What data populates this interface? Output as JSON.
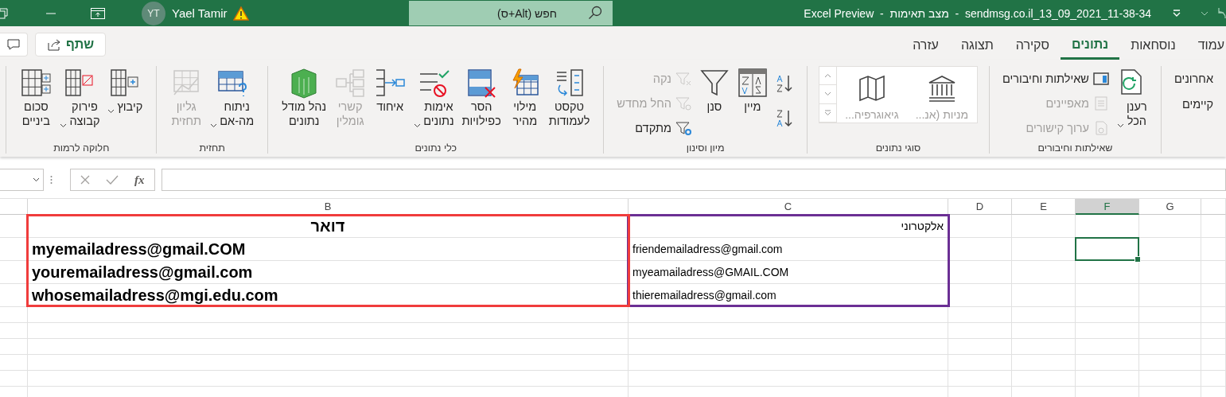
{
  "title_bar": {
    "user": {
      "initials": "YT",
      "name": "Yael Tamir"
    },
    "search": {
      "placeholder": "חפש (Alt+ס)"
    },
    "title": "Excel Preview  -  מצב תאימות  -  sendmsg.co.il_13_09_2021_11-38-34"
  },
  "share_button": {
    "label": "שתף"
  },
  "tabs": [
    {
      "label": "עמוד",
      "selected": false
    },
    {
      "label": "נוסחאות",
      "selected": false
    },
    {
      "label": "נתונים",
      "selected": true
    },
    {
      "label": "סקירה",
      "selected": false
    },
    {
      "label": "תצוגה",
      "selected": false
    },
    {
      "label": "עזרה",
      "selected": false
    }
  ],
  "ribbon": {
    "groups": [
      {
        "items": [
          {
            "kind": "text",
            "label": "אחרונים",
            "disabled": false
          },
          {
            "kind": "text",
            "label": "קיימים",
            "disabled": false
          }
        ]
      },
      {
        "label": "שאילתות וחיבורים",
        "items": [
          {
            "kind": "large",
            "lines": [
              "רענן",
              "הכל"
            ],
            "dropdown": true,
            "disabled": false
          },
          {
            "kind": "small",
            "label": "שאילתות וחיבורים",
            "disabled": false
          },
          {
            "kind": "small",
            "label": "מאפיינים",
            "disabled": true
          },
          {
            "kind": "small",
            "label": "ערוך קישורים",
            "disabled": true
          }
        ]
      },
      {
        "label": "סוגי נתונים",
        "items": [
          {
            "kind": "gallery",
            "label": "מניות (אנ...",
            "disabled": true
          },
          {
            "kind": "gallery",
            "label": "גיאוגרפיה...",
            "disabled": true
          }
        ]
      },
      {
        "label": "מיון וסינון",
        "items": [
          {
            "kind": "icon",
            "disabled": false
          },
          {
            "kind": "icon",
            "disabled": false
          },
          {
            "kind": "large",
            "lines": [
              "מיין"
            ],
            "dropdown": false,
            "disabled": false
          },
          {
            "kind": "large",
            "lines": [
              "סנן"
            ],
            "dropdown": false,
            "disabled": false
          },
          {
            "kind": "small",
            "label": "נקה",
            "disabled": true
          },
          {
            "kind": "small",
            "label": "החל מחדש",
            "disabled": true
          },
          {
            "kind": "small",
            "label": "מתקדם",
            "disabled": false
          }
        ]
      },
      {
        "label": "כלי נתונים",
        "items": [
          {
            "kind": "large",
            "lines": [
              "טקסט",
              "לעמודות"
            ],
            "dropdown": false,
            "disabled": false
          },
          {
            "kind": "large",
            "lines": [
              "מילוי",
              "מהיר"
            ],
            "dropdown": false,
            "disabled": false
          },
          {
            "kind": "large",
            "lines": [
              "הסר",
              "כפילויות"
            ],
            "dropdown": false,
            "disabled": false
          },
          {
            "kind": "large",
            "lines": [
              "אימות",
              "נתונים"
            ],
            "dropdown": true,
            "disabled": false
          },
          {
            "kind": "large",
            "lines": [
              "איחוד"
            ],
            "dropdown": false,
            "disabled": false
          },
          {
            "kind": "large",
            "lines": [
              "קשרי",
              "גומלין"
            ],
            "dropdown": false,
            "disabled": true
          },
          {
            "kind": "large",
            "lines": [
              "נהל מודל",
              "נתונים"
            ],
            "dropdown": false,
            "disabled": false
          }
        ]
      },
      {
        "label": "תחזית",
        "items": [
          {
            "kind": "large",
            "lines": [
              "ניתוח",
              "מה-אם"
            ],
            "dropdown": true,
            "disabled": false
          },
          {
            "kind": "large",
            "lines": [
              "גליון",
              "תחזית"
            ],
            "dropdown": false,
            "disabled": true
          }
        ]
      },
      {
        "label": "חלוקה לרמות",
        "items": [
          {
            "kind": "large",
            "lines": [
              "קיבוץ"
            ],
            "dropdown": true,
            "disabled": false
          },
          {
            "kind": "large",
            "lines": [
              "פירוק",
              "קבוצה"
            ],
            "dropdown": true,
            "disabled": false
          },
          {
            "kind": "large",
            "lines": [
              "סכום",
              "ביניים"
            ],
            "dropdown": false,
            "disabled": false
          }
        ]
      }
    ]
  },
  "formula_bar": {
    "function_label": "fx"
  },
  "sheet": {
    "columns": [
      {
        "label": "G",
        "selected": false
      },
      {
        "label": "F",
        "selected": true,
        "cells": [
          {
            "kind": "empty",
            "selected": false
          },
          {
            "kind": "empty",
            "selected": true
          },
          {
            "kind": "empty",
            "selected": false
          },
          {
            "kind": "empty",
            "selected": false
          }
        ]
      },
      {
        "label": "E",
        "selected": false
      },
      {
        "label": "D",
        "selected": false
      },
      {
        "label": "C",
        "selected": false,
        "color": "#6b2f94",
        "cells": [
          {
            "kind": "text",
            "text": "אלקטרוני"
          },
          {
            "kind": "text",
            "text": "friendemailadress@gmail.com"
          },
          {
            "kind": "text",
            "text": "myeamailadress@GMAIL.COM"
          },
          {
            "kind": "text",
            "text": "thieremailadress@gmail.com"
          }
        ]
      },
      {
        "label": "B",
        "selected": false,
        "color": "#f03c3c",
        "cells": [
          {
            "kind": "heading",
            "text": "דואר"
          },
          {
            "kind": "large",
            "text": "myemailadress@gmail.COM"
          },
          {
            "kind": "large",
            "text": "youremailadress@gmail.com"
          },
          {
            "kind": "large",
            "text": "whosemailadress@mgi.edu.com"
          }
        ]
      }
    ]
  }
}
